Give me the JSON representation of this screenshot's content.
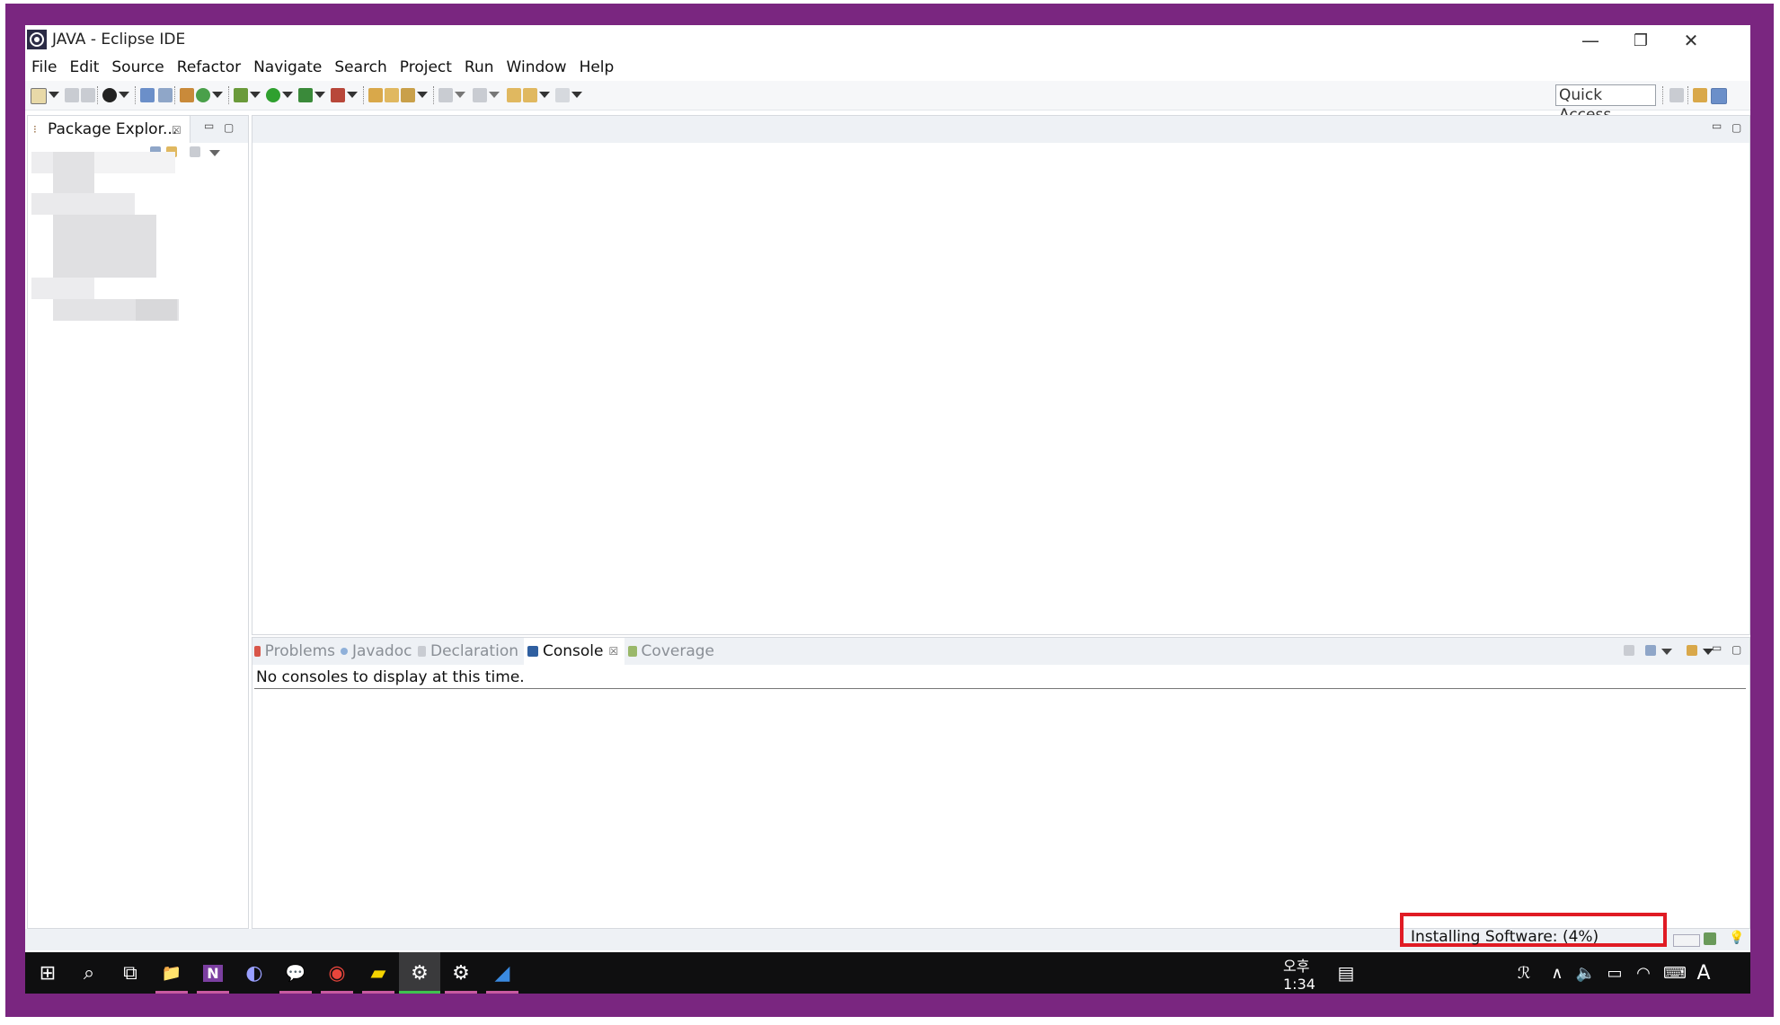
{
  "window": {
    "title": "JAVA - Eclipse IDE",
    "controls": {
      "minimize": "—",
      "restore": "❐",
      "close": "✕"
    }
  },
  "menubar": [
    "File",
    "Edit",
    "Source",
    "Refactor",
    "Navigate",
    "Search",
    "Project",
    "Run",
    "Window",
    "Help"
  ],
  "toolbar": {
    "quick_access": "Quick Access"
  },
  "package_explorer": {
    "tab_label": "Package Explor...",
    "close_glyph": "☒",
    "minimize_glyph": "▭",
    "maximize_glyph": "▢"
  },
  "bottom_panel": {
    "tabs": [
      {
        "label": "Problems",
        "icon_color": "#c0392b",
        "active": false
      },
      {
        "label": "Javadoc",
        "icon_color": "#4a7ab8",
        "active": false
      },
      {
        "label": "Declaration",
        "icon_color": "#9aa0a8",
        "active": false
      },
      {
        "label": "Console",
        "icon_color": "#2f5fa0",
        "active": true
      },
      {
        "label": "Coverage",
        "icon_color": "#6a9a3a",
        "active": false
      }
    ],
    "console_message": "No consoles to display at this time."
  },
  "status": {
    "progress_text": "Installing Software: (4%)",
    "highlight_color": "#e01b24"
  },
  "taskbar": {
    "apps": [
      {
        "name": "start",
        "glyph": "⊞",
        "underline": ""
      },
      {
        "name": "search",
        "glyph": "⌕",
        "underline": ""
      },
      {
        "name": "task-view",
        "glyph": "⧉",
        "underline": ""
      },
      {
        "name": "file-explorer",
        "glyph": "📁",
        "underline": "#c85aa0"
      },
      {
        "name": "onenote",
        "glyph": "N",
        "underline": "#c85aa0"
      },
      {
        "name": "eclipse",
        "glyph": "◐",
        "underline": ""
      },
      {
        "name": "kakaotalk",
        "glyph": "💬",
        "underline": "#c85aa0"
      },
      {
        "name": "chrome",
        "glyph": "◉",
        "underline": "#c85aa0"
      },
      {
        "name": "sticky-notes",
        "glyph": "▰",
        "underline": "#c85aa0"
      },
      {
        "name": "eclipse-active",
        "glyph": "⚙",
        "underline": "#3fc24f"
      },
      {
        "name": "settings",
        "glyph": "⚙",
        "underline": "#c85aa0"
      },
      {
        "name": "app-blue",
        "glyph": "◢",
        "underline": "#c85aa0"
      }
    ],
    "tray": {
      "people_glyph": "ℛ",
      "chevron_glyph": "∧",
      "volume_glyph": "🔈",
      "battery_glyph": "▭",
      "wifi_glyph": "◠",
      "keyboard_glyph": "⌨",
      "ime": "A",
      "time": "오후 1:34",
      "notification_glyph": "▤"
    }
  },
  "colors": {
    "frame": "#7a2680",
    "panel_strip": "#eef1f5",
    "taskbar": "#0f0f10"
  }
}
